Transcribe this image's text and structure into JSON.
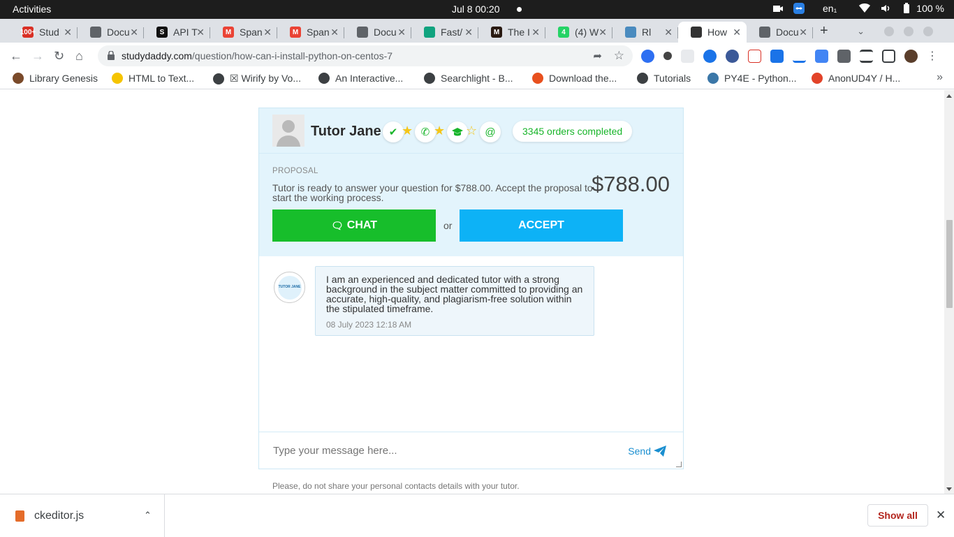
{
  "system": {
    "activities": "Activities",
    "clock": "Jul 8  00:20",
    "lang": "en₁",
    "battery": "100 %"
  },
  "tabs": [
    {
      "label": "Stud",
      "favicon_color": "#d93025",
      "favicon_text": "100+"
    },
    {
      "label": "Docu",
      "favicon_color": "#5f6368",
      "favicon_text": ""
    },
    {
      "label": "API T",
      "favicon_color": "#111111",
      "favicon_text": "S"
    },
    {
      "label": "Span",
      "favicon_color": "#ea4335",
      "favicon_text": "M"
    },
    {
      "label": "Span",
      "favicon_color": "#ea4335",
      "favicon_text": "M"
    },
    {
      "label": "Docu",
      "favicon_color": "#5f6368",
      "favicon_text": ""
    },
    {
      "label": "Fast/",
      "favicon_color": "#10a37f",
      "favicon_text": ""
    },
    {
      "label": "The I",
      "favicon_color": "#2a1a12",
      "favicon_text": "M"
    },
    {
      "label": "(4) W",
      "favicon_color": "#25d366",
      "favicon_text": "4"
    },
    {
      "label": "Rl",
      "favicon_color": "#4a8bbf",
      "favicon_text": ""
    },
    {
      "label": "How",
      "favicon_color": "#333333",
      "favicon_text": "",
      "active": true
    },
    {
      "label": "Docu",
      "favicon_color": "#5f6368",
      "favicon_text": ""
    }
  ],
  "omnibox": {
    "domain": "studydaddy.com",
    "path": "/question/how-can-i-install-python-on-centos-7"
  },
  "bookmarks": [
    {
      "label": "Library Genesis",
      "icon_color": "#7a4a2a"
    },
    {
      "label": "HTML to Text...",
      "icon_color": "#f5c400"
    },
    {
      "label": "☒ Wirify by Vo...",
      "icon_color": "#3c4043"
    },
    {
      "label": "An Interactive...",
      "icon_color": "#3c4043"
    },
    {
      "label": "Searchlight - B...",
      "icon_color": "#3c4043"
    },
    {
      "label": "Download the...",
      "icon_color": "#e8501e"
    },
    {
      "label": "Tutorials",
      "icon_color": "#3c4043"
    },
    {
      "label": "PY4E - Python...",
      "icon_color": "#3b77a8"
    },
    {
      "label": "AnonUD4Y / H...",
      "icon_color": "#e24329"
    }
  ],
  "tutor": {
    "name": "Tutor Jane I",
    "orders_completed": "3345 orders completed",
    "badges": [
      "check",
      "phone",
      "graduation-cap",
      "at"
    ],
    "rating_stars": 2.5
  },
  "proposal": {
    "label": "PROPOSAL",
    "text": "Tutor is ready to answer your question for $788.00. Accept the proposal to start the working process.",
    "price": "$788.00",
    "chat_label": "CHAT",
    "or_label": "or",
    "accept_label": "ACCEPT"
  },
  "message": {
    "avatar_text": "TUTOR JANE",
    "text": "I am an experienced and dedicated tutor with a strong background in the subject matter committed to providing an accurate, high-quality, and plagiarism-free solution within the stipulated timeframe.",
    "timestamp": "08 July 2023 12:18 AM"
  },
  "composer": {
    "placeholder": "Type your message here...",
    "send_label": "Send"
  },
  "notice": "Please, do not share your personal contacts details with your tutor.",
  "downloads": {
    "file_name": "ckeditor.js",
    "show_all": "Show all"
  },
  "colors": {
    "chat_green": "#17be2b",
    "accept_blue": "#0db2f6",
    "head_bg": "#e3f4fc",
    "orders_green": "#18b52a"
  }
}
